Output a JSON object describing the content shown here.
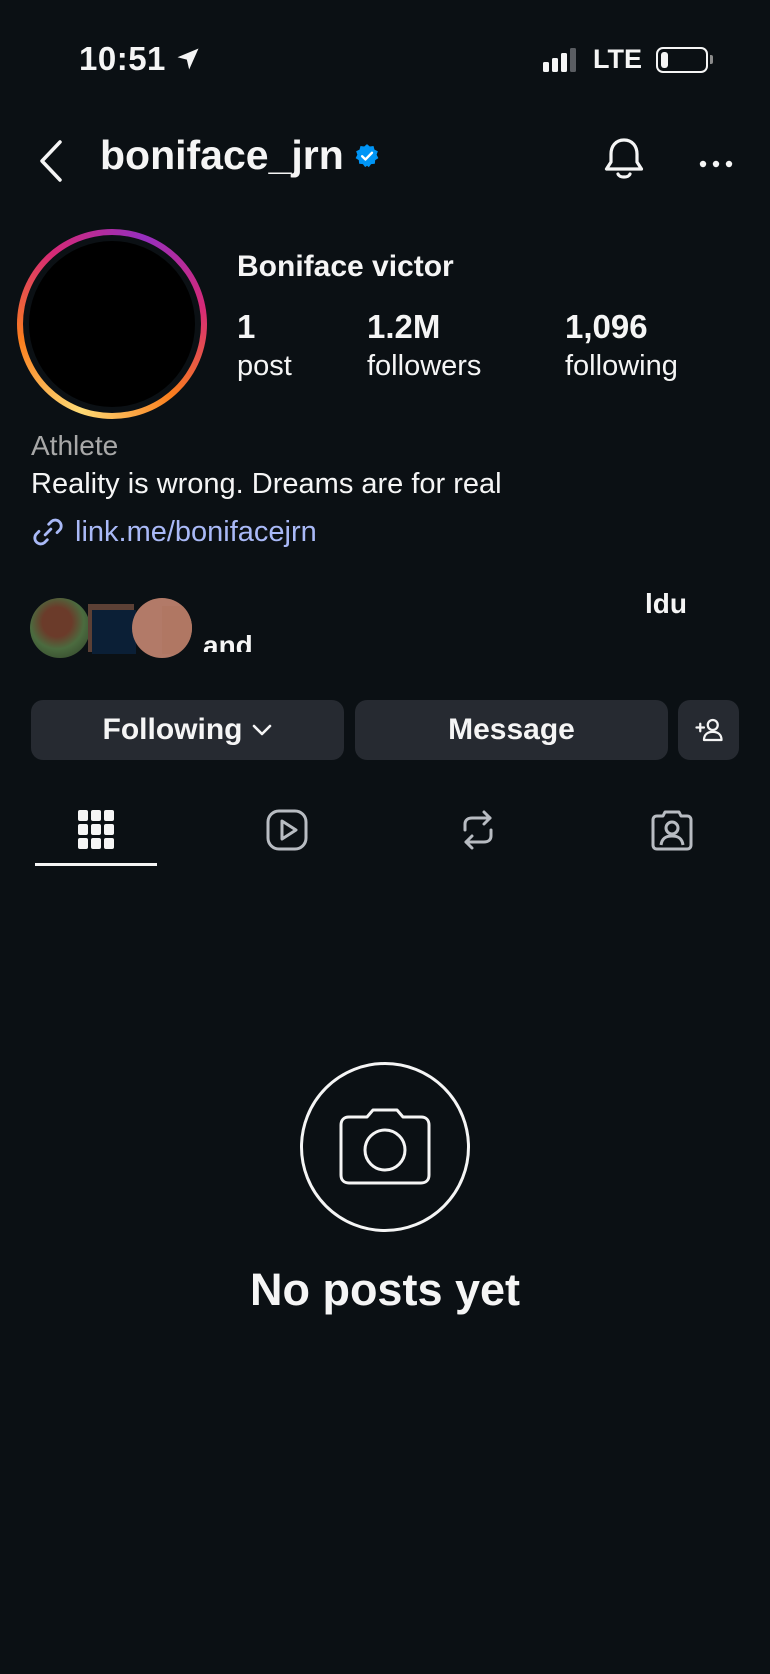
{
  "status_bar": {
    "time": "10:51",
    "network": "LTE",
    "icons": [
      "location-arrow-icon",
      "signal-icon",
      "battery-icon"
    ]
  },
  "header": {
    "username": "boniface_jrn",
    "verified": true,
    "icons": [
      "back-chevron-icon",
      "verified-badge-icon",
      "bell-icon",
      "more-icon"
    ]
  },
  "profile": {
    "display_name": "Boniface victor",
    "stats": {
      "posts": {
        "value": "1",
        "label": "post"
      },
      "followers": {
        "value": "1.2M",
        "label": "followers"
      },
      "following": {
        "value": "1,096",
        "label": "following"
      }
    },
    "category": "Athlete",
    "bio": "Reality is wrong. Dreams are for real",
    "link": "link.me/bonifacejrn"
  },
  "followed_by": {
    "line1_fragment": "ldu",
    "line2_fragment": "and"
  },
  "actions": {
    "following_label": "Following",
    "message_label": "Message"
  },
  "tabs": [
    {
      "name": "grid",
      "icon": "grid-icon",
      "active": true
    },
    {
      "name": "reels",
      "icon": "reels-icon",
      "active": false
    },
    {
      "name": "reposts",
      "icon": "repost-icon",
      "active": false
    },
    {
      "name": "tagged",
      "icon": "tagged-user-icon",
      "active": false
    }
  ],
  "empty_state": {
    "title": "No posts yet",
    "icon": "camera-icon"
  },
  "colors": {
    "background": "#0b1014",
    "button": "#262a31",
    "link": "#a9b9f7",
    "verified": "#0095f6",
    "secondary_text": "#a8a8a8"
  }
}
